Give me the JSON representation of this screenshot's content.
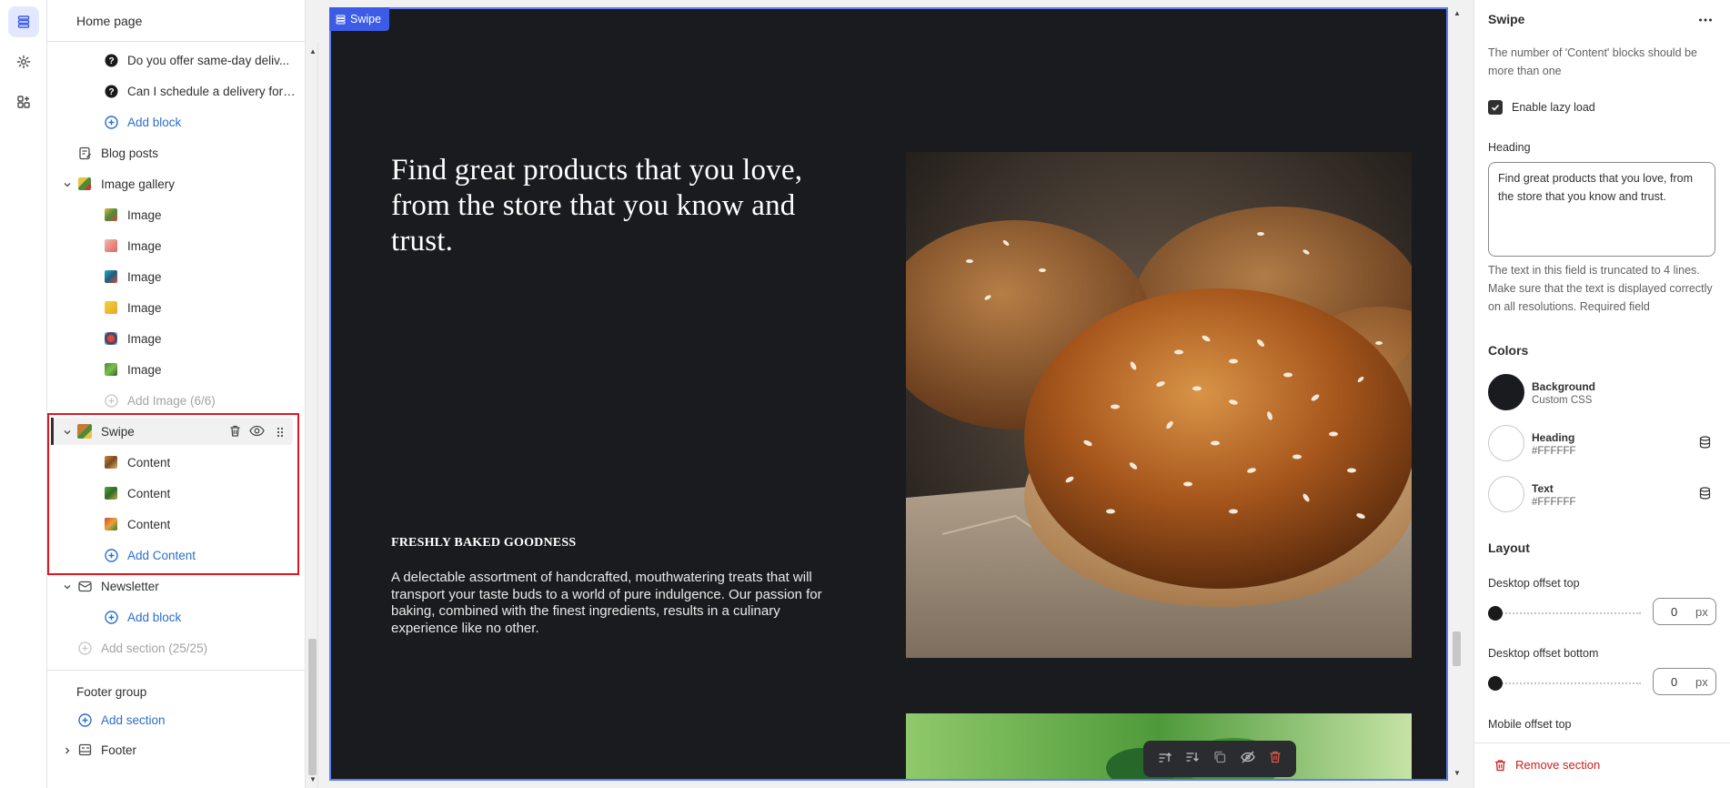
{
  "sidebar": {
    "title": "Home page",
    "faq_items": [
      "Do you offer same-day deliv...",
      "Can I schedule a delivery for ..."
    ],
    "add_block_label": "Add block",
    "blog_posts_label": "Blog posts",
    "image_gallery_label": "Image gallery",
    "image_items": [
      "Image",
      "Image",
      "Image",
      "Image",
      "Image",
      "Image"
    ],
    "add_image_label": "Add Image (6/6)",
    "swipe_label": "Swipe",
    "content_items": [
      "Content",
      "Content",
      "Content"
    ],
    "add_content_label": "Add Content",
    "newsletter_label": "Newsletter",
    "newsletter_add_block": "Add block",
    "add_section_label": "Add section (25/25)",
    "footer_group_label": "Footer group",
    "footer_add_section": "Add section",
    "footer_label": "Footer"
  },
  "preview": {
    "tag_label": "Swipe",
    "heading": "Find great products that you love, from the store that you know and trust.",
    "subtitle": "FRESHLY BAKED GOODNESS",
    "body": "A delectable assortment of handcrafted, mouthwatering treats that will transport your taste buds to a world of pure indulgence. Our passion for baking, combined with the finest ingredients, results in a culinary experience like no other."
  },
  "settings": {
    "title": "Swipe",
    "warning": "The number of 'Content' blocks should be more than one",
    "lazy_load_label": "Enable lazy load",
    "heading_label": "Heading",
    "heading_value": "Find great products that you love, from the store that you know and trust.",
    "heading_help": "The text in this field is truncated to 4 lines. Make sure that the text is displayed correctly on all resolutions. Required field",
    "colors_label": "Colors",
    "colors": [
      {
        "label": "Background",
        "value": "Custom CSS",
        "swatch": "#1a1b1f"
      },
      {
        "label": "Heading",
        "value": "#FFFFFF",
        "swatch": "#ffffff"
      },
      {
        "label": "Text",
        "value": "#FFFFFF",
        "swatch": "#ffffff"
      }
    ],
    "layout_label": "Layout",
    "desktop_offset_top_label": "Desktop offset top",
    "desktop_offset_top_value": "0",
    "desktop_offset_bottom_label": "Desktop offset bottom",
    "desktop_offset_bottom_value": "0",
    "unit": "px",
    "mobile_offset_top_label": "Mobile offset top",
    "remove_section_label": "Remove section"
  },
  "theme": {
    "accent": "#2c6ecb",
    "selection_border": "#e0161e",
    "preview_bg": "#1a1b1f",
    "danger": "#c9201e"
  }
}
